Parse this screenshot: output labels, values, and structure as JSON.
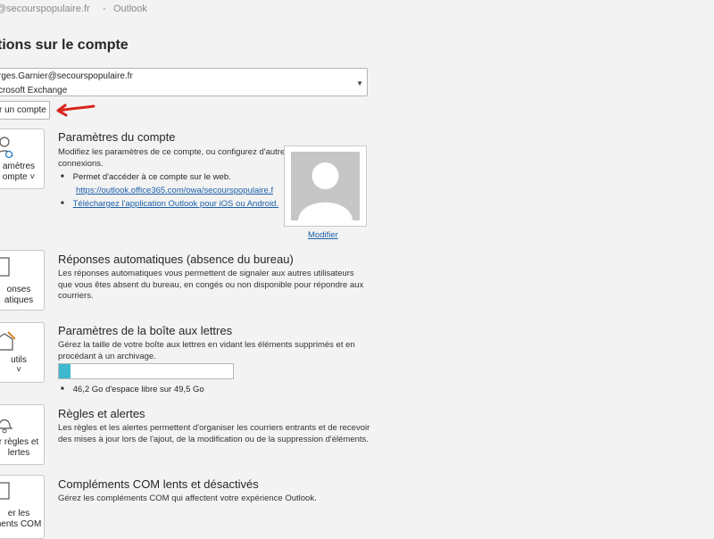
{
  "window": {
    "account_fragment": "@secourspopulaire.fr",
    "separator": "-",
    "app_name": "Outlook"
  },
  "page_title": "tions sur le compte",
  "account": {
    "email": "rges.Garnier@secourspopulaire.fr",
    "type": "crosoft Exchange"
  },
  "add_account_label": "r un compte",
  "tiles": {
    "account_settings": [
      "amètres",
      "ompte ˅"
    ],
    "auto_replies": [
      "onses",
      "atiques"
    ],
    "tools": [
      "utils",
      "˅"
    ],
    "rules": [
      "r règles et",
      "lertes"
    ],
    "com": [
      "er les",
      "nents COM"
    ]
  },
  "sections": {
    "account_settings": {
      "heading": "Paramètres du compte",
      "description": "Modifiez les paramètres de ce compte, ou configurez d'autres connexions.",
      "bullet_web": "Permet d'accéder à ce compte sur le web.",
      "web_link": "https://outlook.office365.com/owa/secourspopulaire.f",
      "app_link": "Téléchargez l'application Outlook pour iOS ou Android.",
      "modify_label": "Modifier"
    },
    "auto_replies": {
      "heading": "Réponses automatiques (absence du bureau)",
      "description": "Les réponses automatiques vous permettent de signaler aux autres utilisateurs que vous êtes absent du bureau, en congés ou non disponible pour répondre aux courriers."
    },
    "mailbox": {
      "heading": "Paramètres de la boîte aux lettres",
      "description": "Gérez la taille de votre boîte aux lettres en vidant les éléments supprimés et en procédant à un archivage.",
      "quota_text": "46,2 Go d'espace libre sur 49,5 Go",
      "used_fraction": 0.067
    },
    "rules": {
      "heading": "Règles et alertes",
      "description": "Les règles et les alertes permettent d'organiser les courriers entrants et de recevoir des mises à jour lors de l'ajout, de la modification ou de la suppression d'éléments."
    },
    "com_addins": {
      "heading": "Compléments COM lents et désactivés",
      "description": "Gérez les compléments COM qui affectent votre expérience Outlook."
    }
  },
  "colors": {
    "link": "#1b5fa8",
    "quota_fill": "#3fb8cf",
    "annotation_arrow": "#d9251d"
  }
}
